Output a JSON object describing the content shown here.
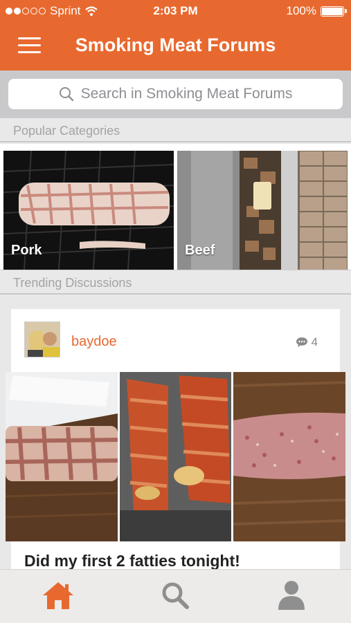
{
  "status_bar": {
    "carrier": "Sprint",
    "time": "2:03 PM",
    "battery": "100%"
  },
  "header": {
    "title": "Smoking Meat Forums"
  },
  "search": {
    "placeholder": "Search in Smoking Meat Forums"
  },
  "sections": {
    "popular": "Popular Categories",
    "trending": "Trending Discussions"
  },
  "categories": [
    {
      "label": "Pork"
    },
    {
      "label": "Beef"
    }
  ],
  "post": {
    "username": "baydoe",
    "comment_count": "4",
    "title": "Did my first 2 fatties tonight!"
  },
  "colors": {
    "brand": "#e8692f",
    "tab_inactive": "#8f8f8f"
  },
  "icons": {
    "menu": "hamburger-icon",
    "search": "search-icon",
    "comments": "comment-bubble-icon",
    "home": "home-icon",
    "tab_search": "search-icon",
    "profile": "user-icon"
  }
}
